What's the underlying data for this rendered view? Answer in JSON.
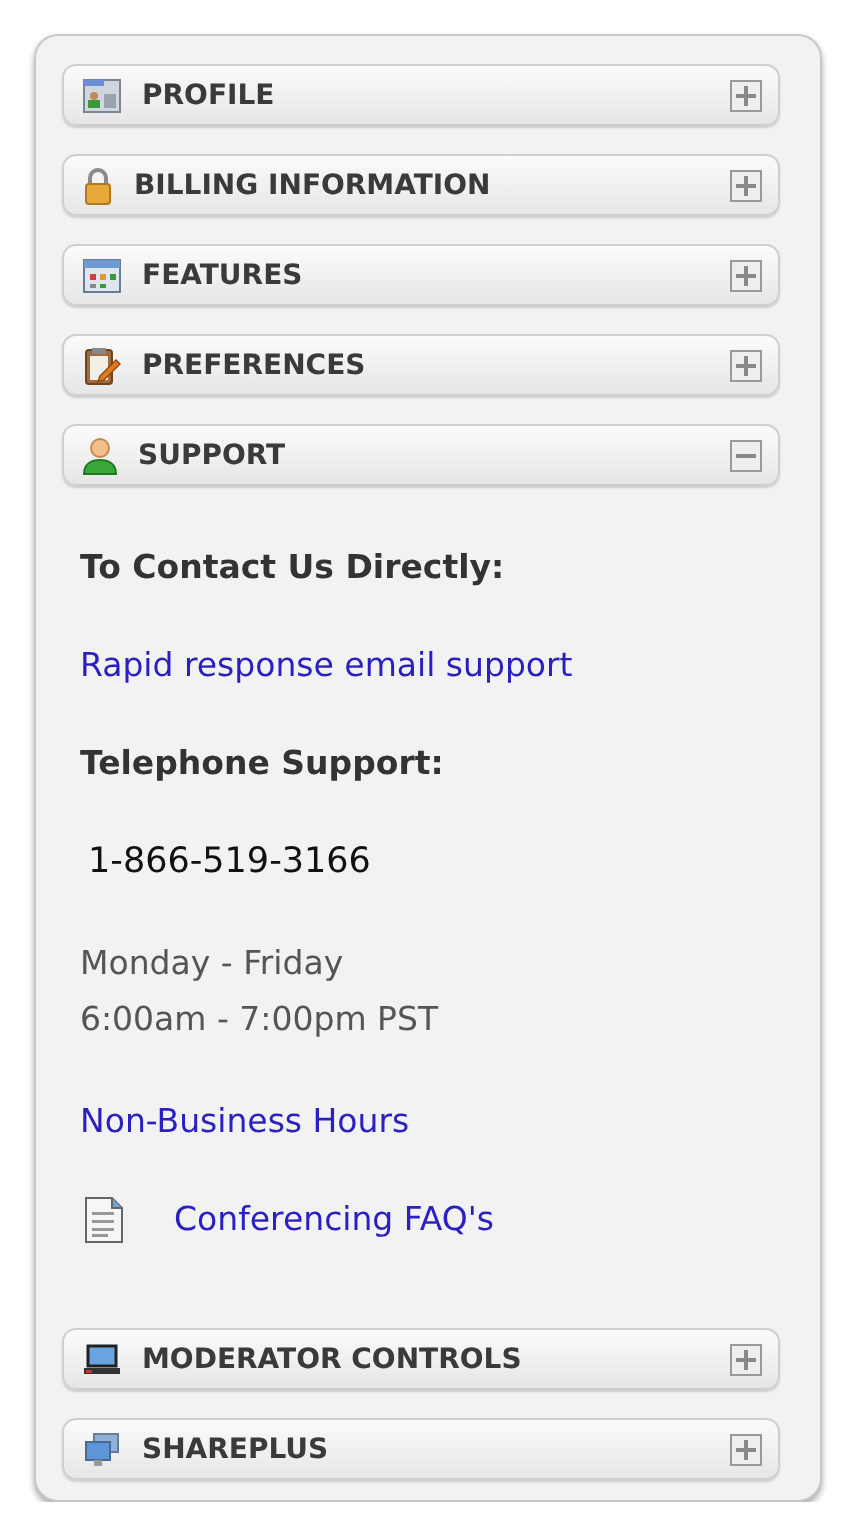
{
  "sections": [
    {
      "title": "PROFILE",
      "kind": "profile",
      "expanded": false
    },
    {
      "title": "BILLING INFORMATION",
      "kind": "lock",
      "expanded": false
    },
    {
      "title": "FEATURES",
      "kind": "features",
      "expanded": false
    },
    {
      "title": "PREFERENCES",
      "kind": "preferences",
      "expanded": false
    },
    {
      "title": "SUPPORT",
      "kind": "person",
      "expanded": true,
      "content": [
        {
          "kind": "heading",
          "text": "To Contact Us Directly:"
        },
        {
          "kind": "link",
          "text": "Rapid response email support"
        },
        {
          "kind": "heading",
          "text": "Telephone Support:"
        },
        {
          "kind": "phone",
          "text": "1-866-519-3166"
        },
        {
          "kind": "hours",
          "lines": [
            "Monday - Friday",
            "6:00am - 7:00pm PST"
          ]
        },
        {
          "kind": "link",
          "text": "Non-Business Hours"
        },
        {
          "kind": "file-link",
          "text": "Conferencing FAQ's"
        }
      ]
    },
    {
      "title": "MODERATOR CONTROLS",
      "kind": "laptop",
      "expanded": false
    },
    {
      "title": "SHAREPLUS",
      "kind": "share",
      "expanded": false
    }
  ]
}
